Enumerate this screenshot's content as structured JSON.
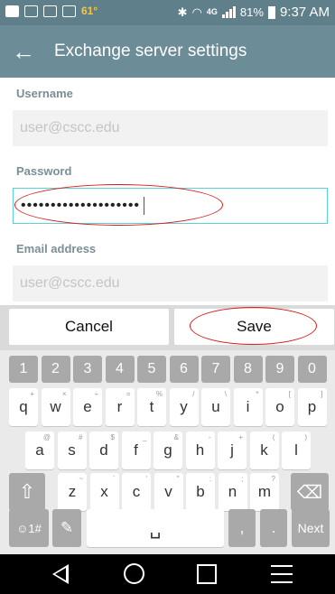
{
  "status_bar": {
    "temperature": "61°",
    "network": "4G",
    "battery": "81%",
    "time": "9:37 AM",
    "icons": [
      "email-icon",
      "keyboard-icon",
      "gallery-icon",
      "camera-icon",
      "bluetooth-icon",
      "wifi-icon",
      "signal-icon",
      "battery-icon"
    ]
  },
  "app_bar": {
    "title": "Exchange server settings",
    "back_icon": "arrow-left-icon"
  },
  "form": {
    "username_label": "Username",
    "username_placeholder": "user@cscc.edu",
    "password_label": "Password",
    "password_value": "••••••••••••••••••••",
    "email_label": "Email address",
    "email_placeholder": "user@cscc.edu"
  },
  "actions": {
    "cancel": "Cancel",
    "save": "Save"
  },
  "keyboard": {
    "numbers": [
      "1",
      "2",
      "3",
      "4",
      "5",
      "6",
      "7",
      "8",
      "9",
      "0"
    ],
    "row1": [
      "q",
      "w",
      "e",
      "r",
      "t",
      "y",
      "u",
      "i",
      "o",
      "p"
    ],
    "row1_sup": [
      "+",
      "×",
      "÷",
      "=",
      "%",
      "/",
      "\\",
      "*",
      "[",
      "]"
    ],
    "row2": [
      "a",
      "s",
      "d",
      "f",
      "g",
      "h",
      "j",
      "k",
      "l"
    ],
    "row2_sup": [
      "@",
      "#",
      "$",
      "_",
      "&",
      "-",
      "+",
      "(",
      ")"
    ],
    "row3": [
      "z",
      "x",
      "c",
      "v",
      "b",
      "n",
      "m"
    ],
    "row3_sup": [
      "~",
      "`",
      "'",
      "\"",
      ":",
      ";",
      "?"
    ],
    "shift_icon": "⇧",
    "backspace_icon": "⌫",
    "symbols_label": "☺1#",
    "pencil_icon": "✎",
    "space_icon": "␣",
    "comma": ",",
    "period": ".",
    "next_label": "Next"
  },
  "accent": {
    "highlight": "#d81b1b",
    "focus": "#5bd1d8",
    "appbar": "#6c8c97"
  }
}
